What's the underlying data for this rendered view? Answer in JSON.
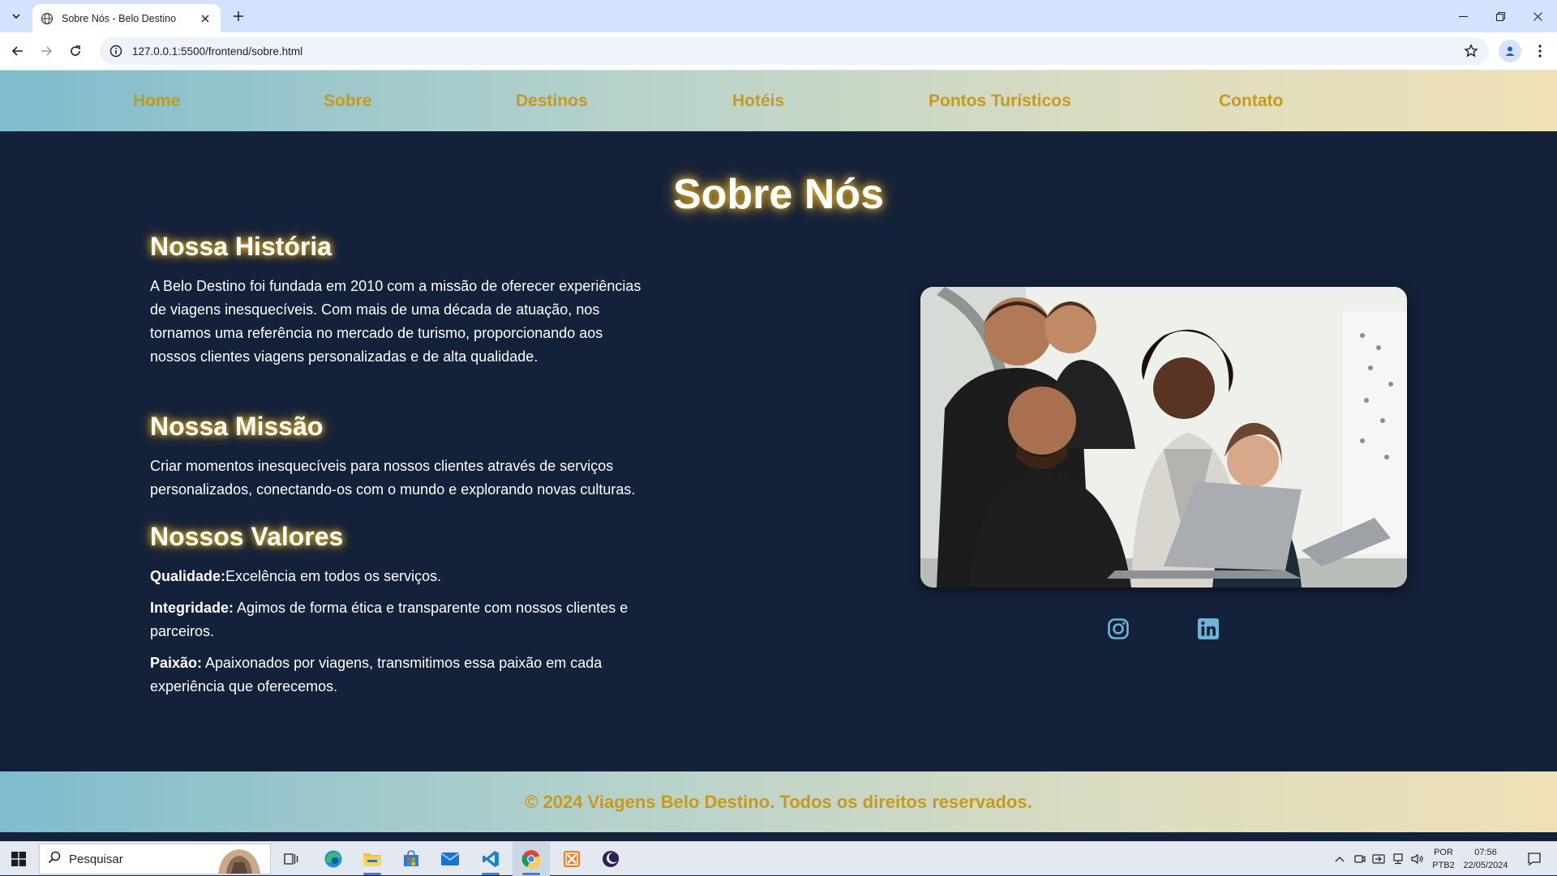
{
  "browser": {
    "tab_title": "Sobre Nós - Belo Destino",
    "url": "127.0.0.1:5500/frontend/sobre.html"
  },
  "nav": {
    "items": [
      "Home",
      "Sobre",
      "Destinos",
      "Hotéis",
      "Pontos Turísticos",
      "Contato"
    ]
  },
  "page": {
    "title": "Sobre Nós",
    "history": {
      "heading": "Nossa História",
      "text": "A Belo Destino foi fundada em 2010 com a missão de oferecer experiências de viagens inesquecíveis. Com mais de uma década de atuação, nos tornamos uma referência no mercado de turismo, proporcionando aos nossos clientes viagens personalizadas e de alta qualidade."
    },
    "mission": {
      "heading": "Nossa Missão",
      "text": "Criar momentos inesquecíveis para nossos clientes através de serviços personalizados, conectando-os com o mundo e explorando novas culturas."
    },
    "values": {
      "heading": "Nossos Valores",
      "items": [
        {
          "label": "Qualidade:",
          "text": "Excelência em todos os serviços."
        },
        {
          "label": "Integridade:",
          "text": " Agimos de forma ética e transparente com nossos clientes e parceiros."
        },
        {
          "label": "Paixão:",
          "text": " Apaixonados por viagens, transmitimos essa paixão em cada experiência que oferecemos."
        }
      ]
    },
    "social": [
      "instagram-icon",
      "linkedin-icon"
    ]
  },
  "footer": {
    "text": "© 2024 Viagens Belo Destino. Todos os direitos reservados."
  },
  "taskbar": {
    "search_placeholder": "Pesquisar",
    "lang_line1": "POR",
    "lang_line2": "PTB2",
    "time": "07:56",
    "date": "22/05/2024"
  },
  "colors": {
    "background": "#14213a",
    "nav_text": "#c79a1e",
    "heading_glow": "#e8b830",
    "social_icon": "#6fb3d6"
  }
}
